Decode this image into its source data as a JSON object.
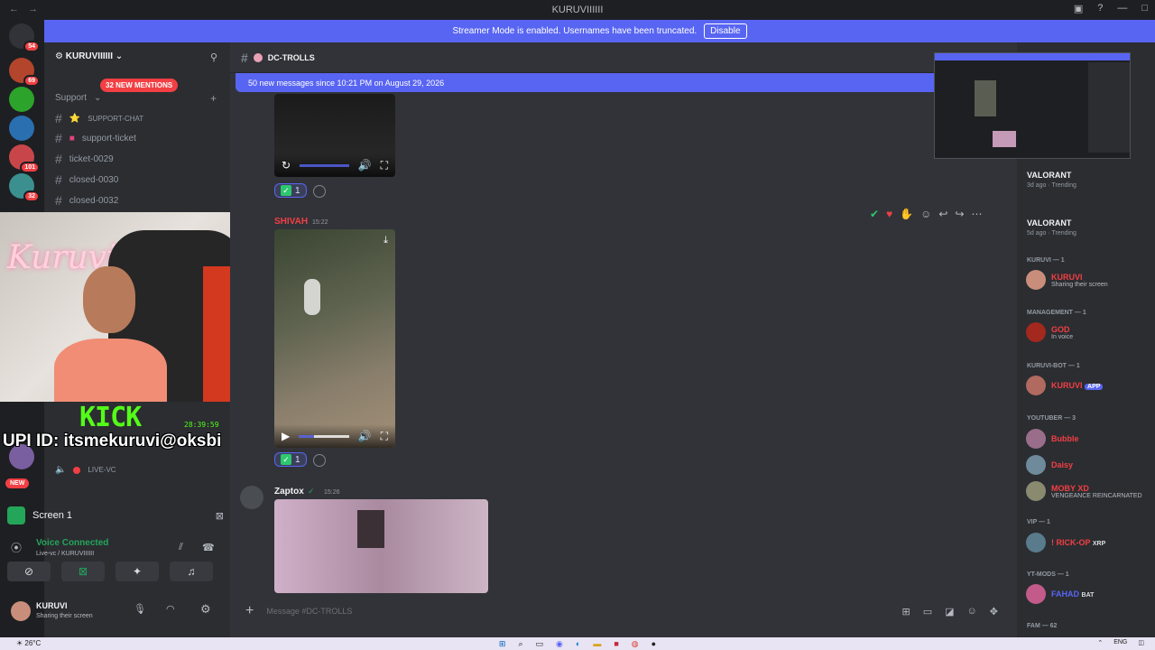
{
  "window": {
    "title": "KURUVIIIIII",
    "back": "←",
    "forward": "→"
  },
  "banner": {
    "text": "Streamer Mode is enabled. Usernames have been truncated.",
    "button": "Disable"
  },
  "rail": {
    "badge_top": "54",
    "badges": [
      "69",
      "101",
      "32"
    ],
    "new_label": "NEW"
  },
  "sidebar": {
    "guild": "KURUVIIIIII",
    "mentions": "32 NEW MENTIONS",
    "category": "Support",
    "channels": [
      {
        "name": "SUPPORT-CHAT",
        "emoji": "⭐"
      },
      {
        "name": "support-ticket",
        "emoji": "■"
      },
      {
        "name": "ticket-0029"
      },
      {
        "name": "closed-0030"
      },
      {
        "name": "closed-0032"
      }
    ],
    "voice_channel": "LIVE-VC"
  },
  "overlay": {
    "brand": "KICK",
    "timer": "28:39:59",
    "upi": "UPI ID: itsmekuruvi@oksbi"
  },
  "screen_share": {
    "label": "Screen 1"
  },
  "voice": {
    "status": "Voice Connected",
    "channel": "Live-vc / KURUVIIIIII"
  },
  "user": {
    "name": "KURUVI",
    "status": "Sharing their screen"
  },
  "chat": {
    "channel": "DC-TROLLS",
    "new_messages": "50 new messages since 10:21 PM on August 29, 2026",
    "messages": [
      {
        "author": "",
        "time": "",
        "reaction_count": "1"
      },
      {
        "author": "SHIVAH",
        "time": "15:22",
        "reaction_count": "1",
        "author_color": "#f23f43"
      },
      {
        "author": "Zaptox",
        "time": "15:26",
        "author_color": "#f2f3f5"
      }
    ],
    "composer_placeholder": "Message #DC-TROLLS"
  },
  "members": {
    "activities": [
      {
        "game": "VALORANT",
        "meta": "3d ago · Trending"
      },
      {
        "game": "VALORANT",
        "meta": "5d ago · Trending"
      }
    ],
    "groups": [
      {
        "title": "KURUVI — 1",
        "members": [
          {
            "name": "KURUVI",
            "status": "Sharing their screen",
            "color": "#f23f43"
          }
        ]
      },
      {
        "title": "MANAGEMENT — 1",
        "members": [
          {
            "name": "GOD",
            "status": "In voice",
            "color": "#f23f43"
          }
        ]
      },
      {
        "title": "KURUVI-BOT — 1",
        "members": [
          {
            "name": "KURUVI",
            "tag": "APP",
            "status": "",
            "color": "#f23f43"
          }
        ]
      },
      {
        "title": "YOUTUBER — 3",
        "members": [
          {
            "name": "Bubble",
            "status": "",
            "color": "#f23f43"
          },
          {
            "name": "Daisy",
            "status": "",
            "color": "#f23f43"
          },
          {
            "name": "MOBY XD",
            "status": "VENGEANCE REINCARNATED",
            "color": "#f23f43"
          }
        ]
      },
      {
        "title": "VIP — 1",
        "members": [
          {
            "name": "! RICK-OP",
            "tag": "XRP",
            "status": "",
            "color": "#f23f43"
          }
        ]
      },
      {
        "title": "YT-MODS — 1",
        "members": [
          {
            "name": "FAHAD",
            "tag": "BAT",
            "status": "",
            "color": "#5865f2"
          }
        ]
      },
      {
        "title": "FAM — 62",
        "members": []
      }
    ]
  },
  "taskbar": {
    "weather": "26°C",
    "lang": "ENG"
  },
  "colors": {
    "accent": "#5865f2",
    "danger": "#f23f43",
    "kick": "#53fc18"
  }
}
